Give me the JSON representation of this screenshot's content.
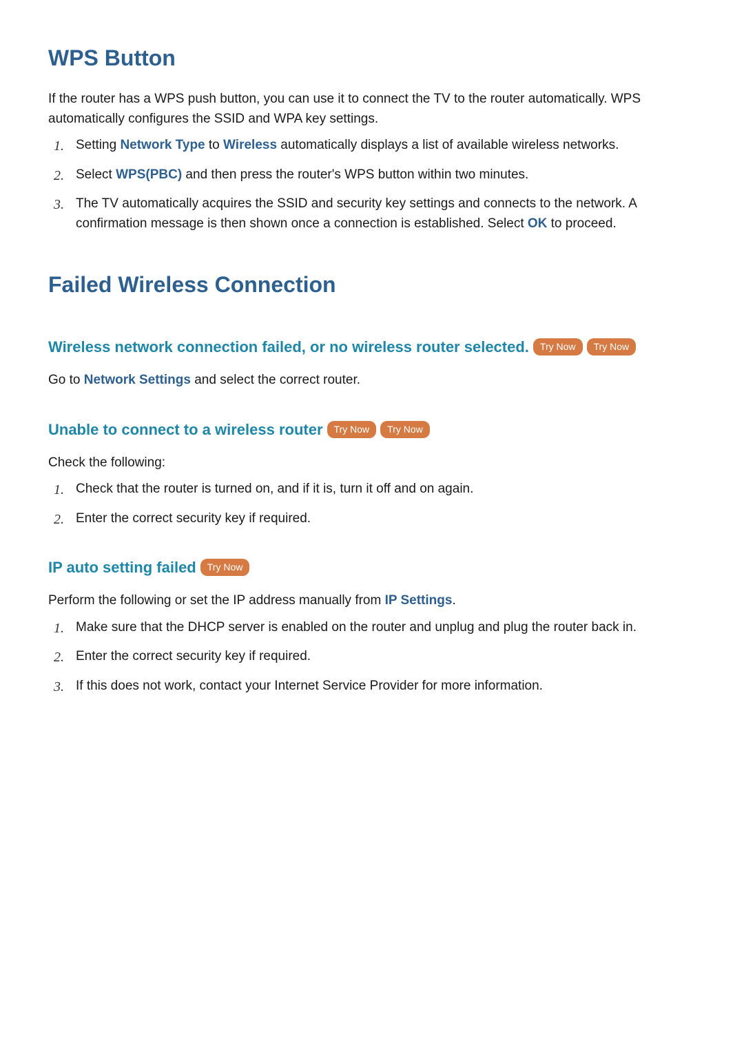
{
  "headings": {
    "wps_button": "WPS Button",
    "failed_wireless": "Failed Wireless Connection",
    "wireless_failed": "Wireless network connection failed, or no wireless router selected.",
    "unable_connect": "Unable to connect to a wireless router",
    "ip_auto_failed": "IP auto setting failed"
  },
  "wps": {
    "intro": "If the router has a WPS push button, you can use it to connect the TV to the router automatically. WPS automatically configures the SSID and WPA key settings.",
    "steps": {
      "1_prefix": "Setting ",
      "1_link1": "Network Type",
      "1_mid": " to ",
      "1_link2": "Wireless",
      "1_suffix": " automatically displays a list of available wireless networks.",
      "2_prefix": "Select ",
      "2_link": "WPS(PBC)",
      "2_suffix": " and then press the router's WPS button within two minutes.",
      "3_prefix": "The TV automatically acquires the SSID and security key settings and connects to the network. A confirmation message is then shown once a connection is established. Select ",
      "3_link": "OK",
      "3_suffix": " to proceed."
    }
  },
  "wireless_failed": {
    "body_prefix": "Go to ",
    "body_link": "Network Settings",
    "body_suffix": " and select the correct router."
  },
  "unable_connect": {
    "intro": "Check the following:",
    "steps": {
      "1": "Check that the router is turned on, and if it is, turn it off and on again.",
      "2": "Enter the correct security key if required."
    }
  },
  "ip_auto": {
    "intro_prefix": "Perform the following or set the IP address manually from ",
    "intro_link": "IP Settings",
    "intro_suffix": ".",
    "steps": {
      "1": "Make sure that the DHCP server is enabled on the router and unplug and plug the router back in.",
      "2": "Enter the correct security key if required.",
      "3": "If this does not work, contact your Internet Service Provider for more information."
    }
  },
  "labels": {
    "try_now": "Try Now",
    "num1": "1.",
    "num2": "2.",
    "num3": "3."
  }
}
